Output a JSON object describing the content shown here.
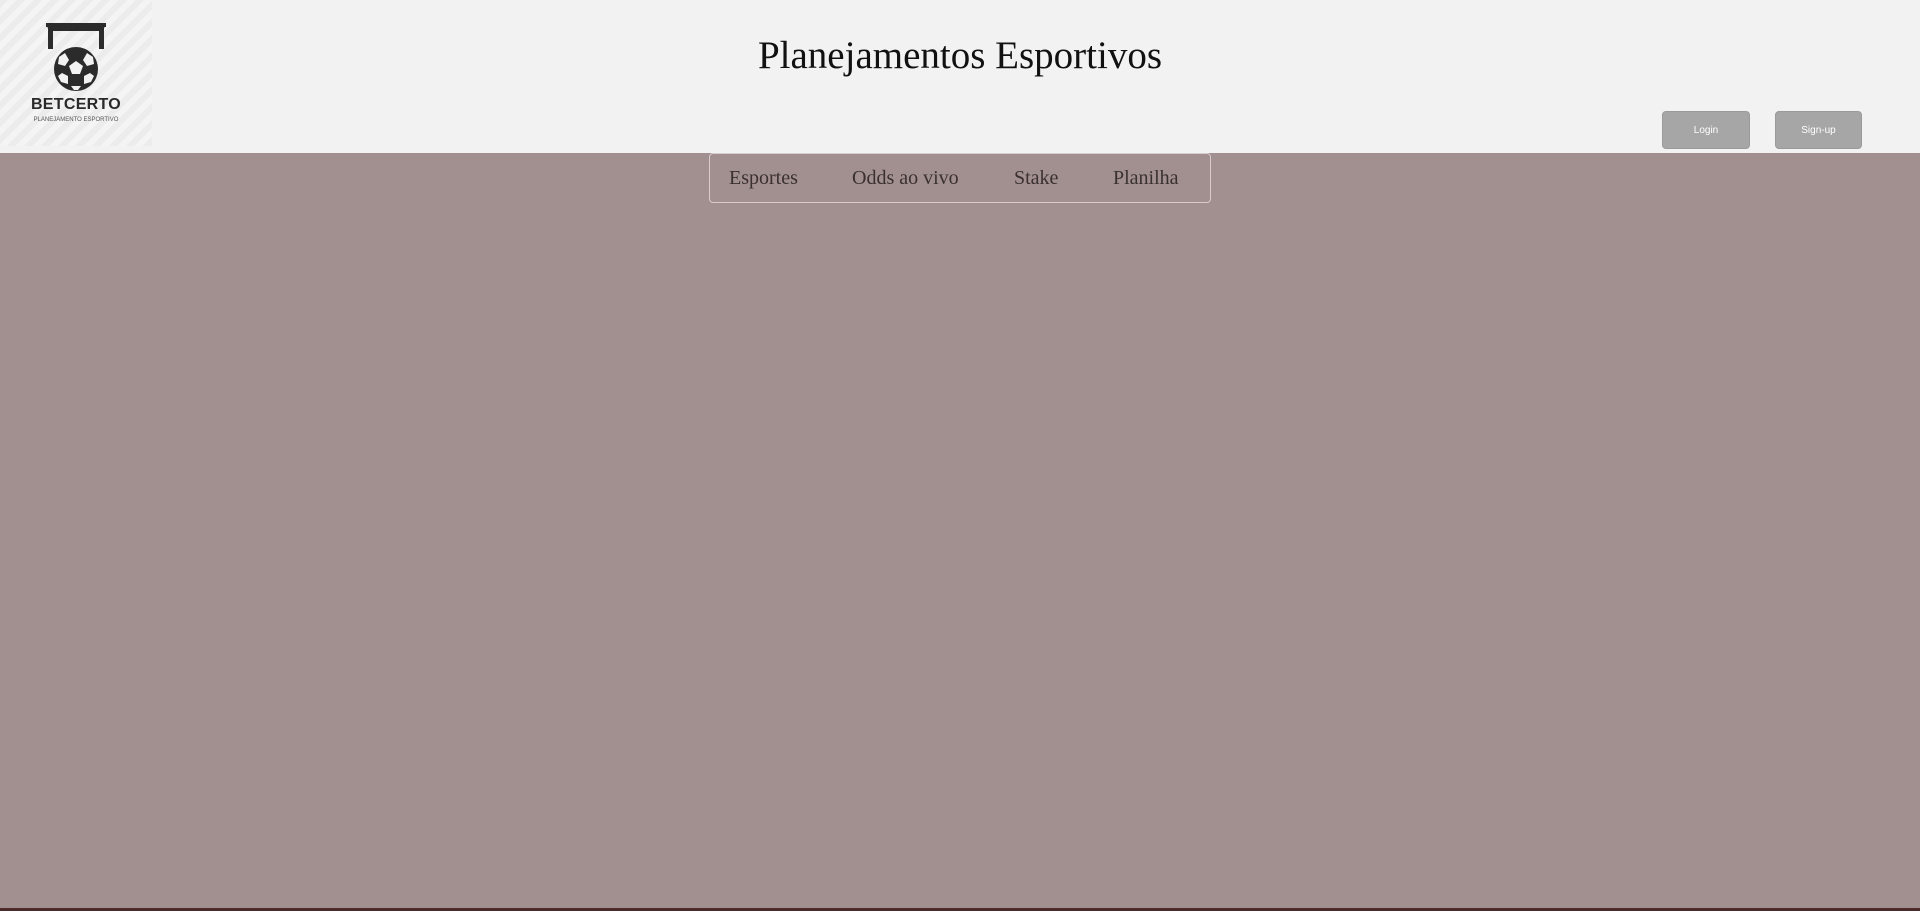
{
  "header": {
    "title": "Planejamentos Esportivos",
    "background": "#f2f2f2"
  },
  "logo": {
    "icon": "soccer-goal-ball-icon",
    "wordmark": "BETCERTO",
    "tagline": "PLANEJAMENTO ESPORTIVO"
  },
  "auth": {
    "login_label": "Login",
    "signup_label": "Sign-up",
    "button_color": "#a6a6a6"
  },
  "nav": {
    "items": [
      {
        "label": "Esportes"
      },
      {
        "label": "Odds ao vivo"
      },
      {
        "label": "Stake"
      },
      {
        "label": "Planilha"
      }
    ]
  },
  "colors": {
    "page_background": "#a29090",
    "text": "#111111"
  }
}
